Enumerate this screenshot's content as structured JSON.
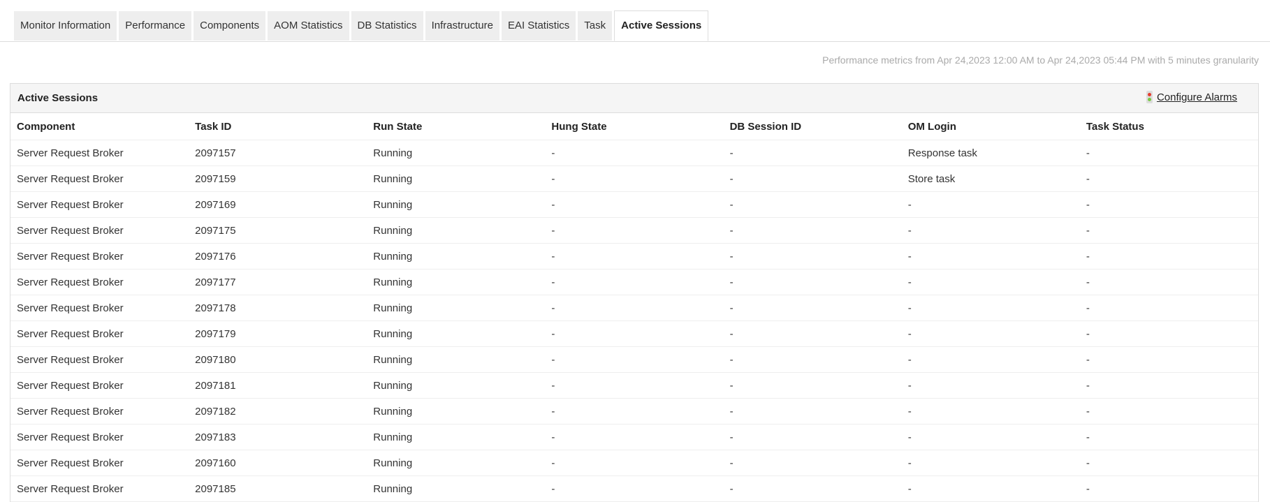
{
  "tabs": [
    "Monitor Information",
    "Performance",
    "Components",
    "AOM Statistics",
    "DB Statistics",
    "Infrastructure",
    "EAI Statistics",
    "Task",
    "Active Sessions"
  ],
  "active_tab": "Active Sessions",
  "metrics_text": "Performance metrics from Apr 24,2023 12:00 AM to Apr 24,2023 05:44 PM with 5 minutes granularity",
  "panel": {
    "title": "Active Sessions",
    "configure_alarms": "Configure Alarms",
    "icon": "traffic-light-icon"
  },
  "table": {
    "columns": [
      "Component",
      "Task ID",
      "Run State",
      "Hung State",
      "DB Session ID",
      "OM Login",
      "Task Status"
    ],
    "rows": [
      [
        "Server Request Broker",
        "2097157",
        "Running",
        "-",
        "-",
        "Response task",
        "-"
      ],
      [
        "Server Request Broker",
        "2097159",
        "Running",
        "-",
        "-",
        "Store task",
        "-"
      ],
      [
        "Server Request Broker",
        "2097169",
        "Running",
        "-",
        "-",
        "-",
        "-"
      ],
      [
        "Server Request Broker",
        "2097175",
        "Running",
        "-",
        "-",
        "-",
        "-"
      ],
      [
        "Server Request Broker",
        "2097176",
        "Running",
        "-",
        "-",
        "-",
        "-"
      ],
      [
        "Server Request Broker",
        "2097177",
        "Running",
        "-",
        "-",
        "-",
        "-"
      ],
      [
        "Server Request Broker",
        "2097178",
        "Running",
        "-",
        "-",
        "-",
        "-"
      ],
      [
        "Server Request Broker",
        "2097179",
        "Running",
        "-",
        "-",
        "-",
        "-"
      ],
      [
        "Server Request Broker",
        "2097180",
        "Running",
        "-",
        "-",
        "-",
        "-"
      ],
      [
        "Server Request Broker",
        "2097181",
        "Running",
        "-",
        "-",
        "-",
        "-"
      ],
      [
        "Server Request Broker",
        "2097182",
        "Running",
        "-",
        "-",
        "-",
        "-"
      ],
      [
        "Server Request Broker",
        "2097183",
        "Running",
        "-",
        "-",
        "-",
        "-"
      ],
      [
        "Server Request Broker",
        "2097160",
        "Running",
        "-",
        "-",
        "-",
        "-"
      ],
      [
        "Server Request Broker",
        "2097185",
        "Running",
        "-",
        "-",
        "-",
        "-"
      ]
    ]
  }
}
